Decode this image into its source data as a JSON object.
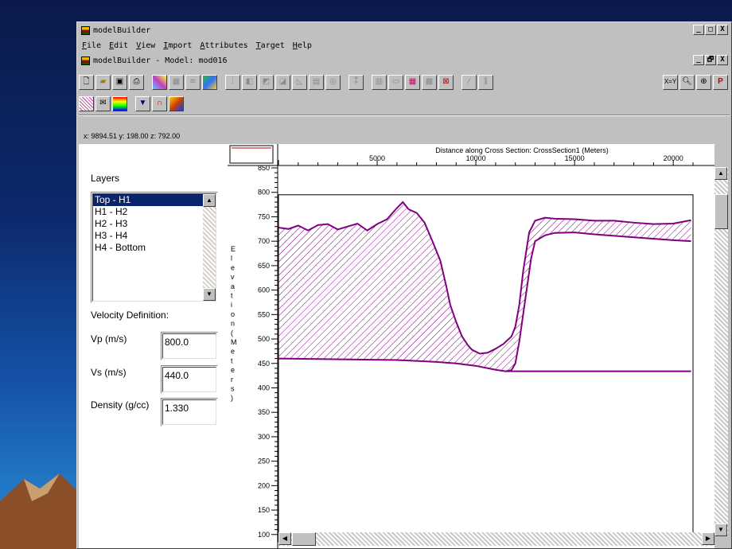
{
  "window_title": "modelBuilder",
  "menu": [
    "File",
    "Edit",
    "View",
    "Import",
    "Attributes",
    "Target",
    "Help"
  ],
  "child_title": "modelBuilder - Model: mod016",
  "caption_buttons": {
    "minimize": "_",
    "restore": "□",
    "close": "X",
    "child_restore": "🗗"
  },
  "toolbar_tools": [
    "new-file",
    "open-folder",
    "save",
    "print",
    "color-grid",
    "grid-dim",
    "layers-dim",
    "world-map",
    "tool-dim-1",
    "tool-dim-2",
    "tool-dim-3",
    "tool-dim-4",
    "tool-dim-5",
    "tool-dim-6",
    "tool-dim-7",
    "tool-dim-8",
    "tool-dim-9",
    "tool-dim-10",
    "table-grid",
    "cross-section",
    "tool-dim-11",
    "tool-dim-12"
  ],
  "toolbar_right": {
    "xy_label": "X=Y",
    "zoom_out": "zoom-out-icon",
    "zoom_in": "zoom-in-icon",
    "properties": "P"
  },
  "toolbar2_tools": [
    "hatch-layer",
    "envelope",
    "spectrum",
    "down-arrow",
    "magnet",
    "seismic"
  ],
  "coords": {
    "text": "x:  9894.51  y:   198.00  z:   792.00"
  },
  "layers": {
    "title": "Layers",
    "items": [
      "Top - H1",
      "H1 - H2",
      "H2 - H3",
      "H3 - H4",
      "H4 - Bottom"
    ],
    "selected_index": 0
  },
  "velocity": {
    "title": "Velocity Definition:",
    "vp_label": "Vp (m/s)",
    "vp_value": "800.0",
    "vs_label": "Vs (m/s)",
    "vs_value": "440.0",
    "density_label": "Density (g/cc)",
    "density_value": "1.330"
  },
  "colors": {
    "layer_line": "#800080",
    "selection": "#0a246a",
    "thumbnail_line": "#c00000"
  },
  "chart_data": {
    "type": "line",
    "xlabel": "Distance along Cross Section: CrossSection1 (Meters)",
    "ylabel": "Elevation (Meters)",
    "xlim": [
      0,
      21000
    ],
    "ylim": [
      85,
      850
    ],
    "xticks": [
      5000,
      10000,
      15000,
      20000
    ],
    "yticks": [
      100,
      150,
      200,
      250,
      300,
      350,
      400,
      450,
      500,
      550,
      600,
      650,
      700,
      750,
      800,
      850
    ],
    "fill": "hatched",
    "series": [
      {
        "role": "top",
        "x": [
          0,
          500,
          1000,
          1500,
          2000,
          2500,
          3000,
          3500,
          4000,
          4500,
          5000,
          5500,
          6000,
          6300,
          6600,
          7000,
          7400,
          7800,
          8200,
          8500,
          8700,
          9000,
          9300,
          9600,
          9800,
          10200,
          10600,
          11000,
          11400,
          11800,
          12000,
          12200,
          12400,
          12700,
          13000,
          13500,
          14000,
          15000,
          16000,
          17000,
          18000,
          19000,
          20000,
          20500,
          20900
        ],
        "y": [
          728,
          725,
          732,
          722,
          733,
          735,
          724,
          730,
          736,
          722,
          735,
          745,
          768,
          780,
          765,
          758,
          738,
          700,
          660,
          608,
          570,
          535,
          505,
          487,
          478,
          470,
          472,
          480,
          490,
          505,
          525,
          570,
          640,
          718,
          742,
          748,
          746,
          745,
          742,
          742,
          738,
          735,
          736,
          740,
          743
        ]
      },
      {
        "role": "base",
        "x": [
          0,
          2000,
          4000,
          6000,
          8000,
          9000,
          10000,
          11000,
          11500,
          11800,
          12000,
          12200,
          12500,
          12800,
          13000,
          13500,
          14000,
          15000,
          16000,
          18000,
          20000,
          20900
        ],
        "y": [
          460,
          459,
          458,
          457,
          453,
          450,
          445,
          437,
          434,
          436,
          450,
          495,
          580,
          665,
          700,
          712,
          717,
          718,
          714,
          708,
          702,
          700
        ]
      },
      {
        "role": "floor",
        "x": [
          11500,
          14000,
          17000,
          20900
        ],
        "y": [
          434,
          434,
          434,
          434
        ]
      }
    ]
  }
}
